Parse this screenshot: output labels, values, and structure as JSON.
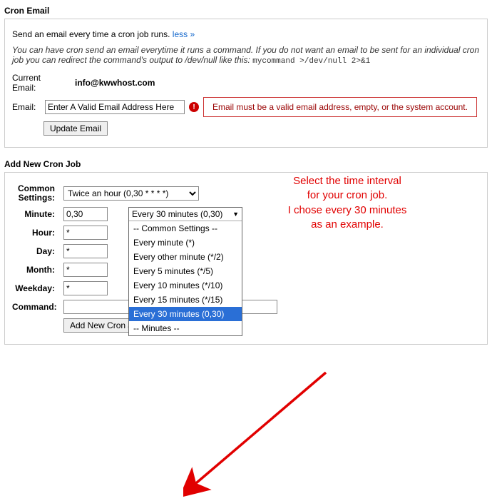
{
  "cronEmail": {
    "title": "Cron Email",
    "desc": "Send an email every time a cron job runs.",
    "lessLink": "less »",
    "hint_pre": "You can have cron send an email everytime it runs a command. If you do not want an email to be sent for an individual cron job you can redirect the command's output to /dev/null like this: ",
    "hint_code": "mycommand >/dev/null 2>&1",
    "currentEmailLabel": "Current Email:",
    "currentEmail": "info@kwwhost.com",
    "emailLabel": "Email:",
    "emailValue": "Enter A Valid Email Address Here",
    "errorIcon": "!",
    "errorMsg": "Email must be a valid email address, empty, or the system account.",
    "updateBtn": "Update Email"
  },
  "addCron": {
    "title": "Add New Cron Job",
    "commonLabel": "Common Settings:",
    "commonSelected": "Twice an hour (0,30 * * * *)",
    "rows": {
      "minute": {
        "label": "Minute:",
        "value": "0,30",
        "preset": "Every 30 minutes (0,30)"
      },
      "hour": {
        "label": "Hour:",
        "value": "*"
      },
      "day": {
        "label": "Day:",
        "value": "*"
      },
      "month": {
        "label": "Month:",
        "value": "*"
      },
      "weekday": {
        "label": "Weekday:",
        "value": "*"
      }
    },
    "ok": "✓",
    "dropdown": {
      "header": "Every 30 minutes (0,30)",
      "options": [
        "-- Common Settings --",
        "Every minute (*)",
        "Every other minute (*/2)",
        "Every 5 minutes (*/5)",
        "Every 10 minutes (*/10)",
        "Every 15 minutes (*/15)",
        "Every 30 minutes (0,30)",
        "-- Minutes --"
      ],
      "selectedIndex": 6
    },
    "commandLabel": "Command:",
    "addBtn": "Add New Cron Job"
  },
  "annotation": {
    "line1": "Select the time interval",
    "line2": "for your cron job.",
    "line3": "I chose every 30 minutes",
    "line4": "as an example."
  }
}
